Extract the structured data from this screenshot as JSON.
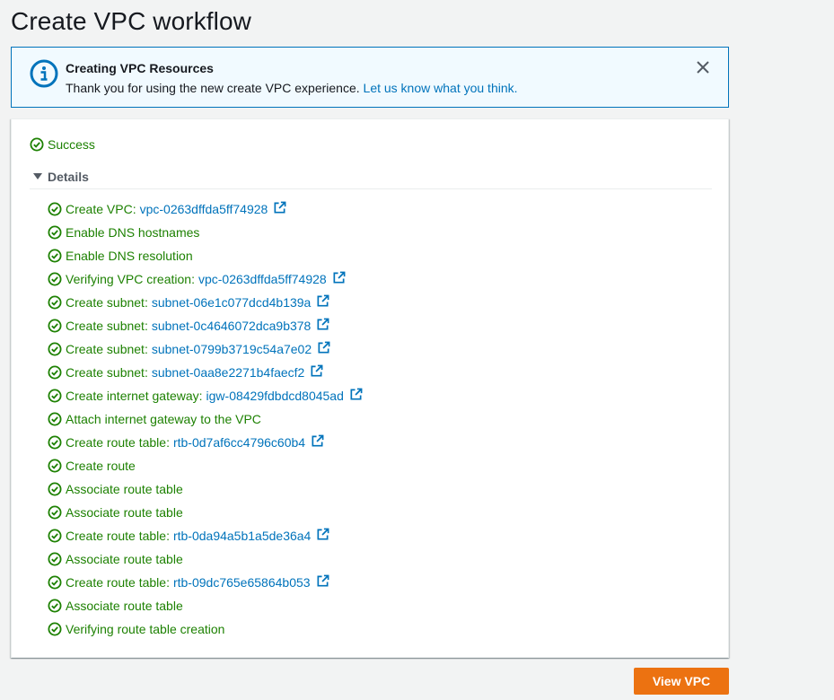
{
  "page": {
    "title": "Create VPC workflow"
  },
  "flash": {
    "title": "Creating VPC Resources",
    "message": "Thank you for using the new create VPC experience.",
    "link_text": "Let us know what you think.",
    "icon": "info-icon",
    "close_icon": "close-icon"
  },
  "status": {
    "label": "Success",
    "icon": "check-circle-icon"
  },
  "details": {
    "label": "Details",
    "expanded": true
  },
  "steps": [
    {
      "label": "Create VPC:",
      "link": "vpc-0263dffda5ff74928"
    },
    {
      "label": "Enable DNS hostnames"
    },
    {
      "label": "Enable DNS resolution"
    },
    {
      "label": "Verifying VPC creation:",
      "link": "vpc-0263dffda5ff74928"
    },
    {
      "label": "Create subnet:",
      "link": "subnet-06e1c077dcd4b139a"
    },
    {
      "label": "Create subnet:",
      "link": "subnet-0c4646072dca9b378"
    },
    {
      "label": "Create subnet:",
      "link": "subnet-0799b3719c54a7e02"
    },
    {
      "label": "Create subnet:",
      "link": "subnet-0aa8e2271b4faecf2"
    },
    {
      "label": "Create internet gateway:",
      "link": "igw-08429fdbdcd8045ad"
    },
    {
      "label": "Attach internet gateway to the VPC"
    },
    {
      "label": "Create route table:",
      "link": "rtb-0d7af6cc4796c60b4"
    },
    {
      "label": "Create route"
    },
    {
      "label": "Associate route table"
    },
    {
      "label": "Associate route table"
    },
    {
      "label": "Create route table:",
      "link": "rtb-0da94a5b1a5de36a4"
    },
    {
      "label": "Associate route table"
    },
    {
      "label": "Create route table:",
      "link": "rtb-09dc765e65864b053"
    },
    {
      "label": "Associate route table"
    },
    {
      "label": "Verifying route table creation"
    }
  ],
  "actions": {
    "view_vpc": "View VPC"
  },
  "colors": {
    "success": "#1d8102",
    "link": "#0073bb",
    "primary": "#ec7211",
    "info_border": "#0073bb",
    "info_bg": "#f1faff"
  }
}
